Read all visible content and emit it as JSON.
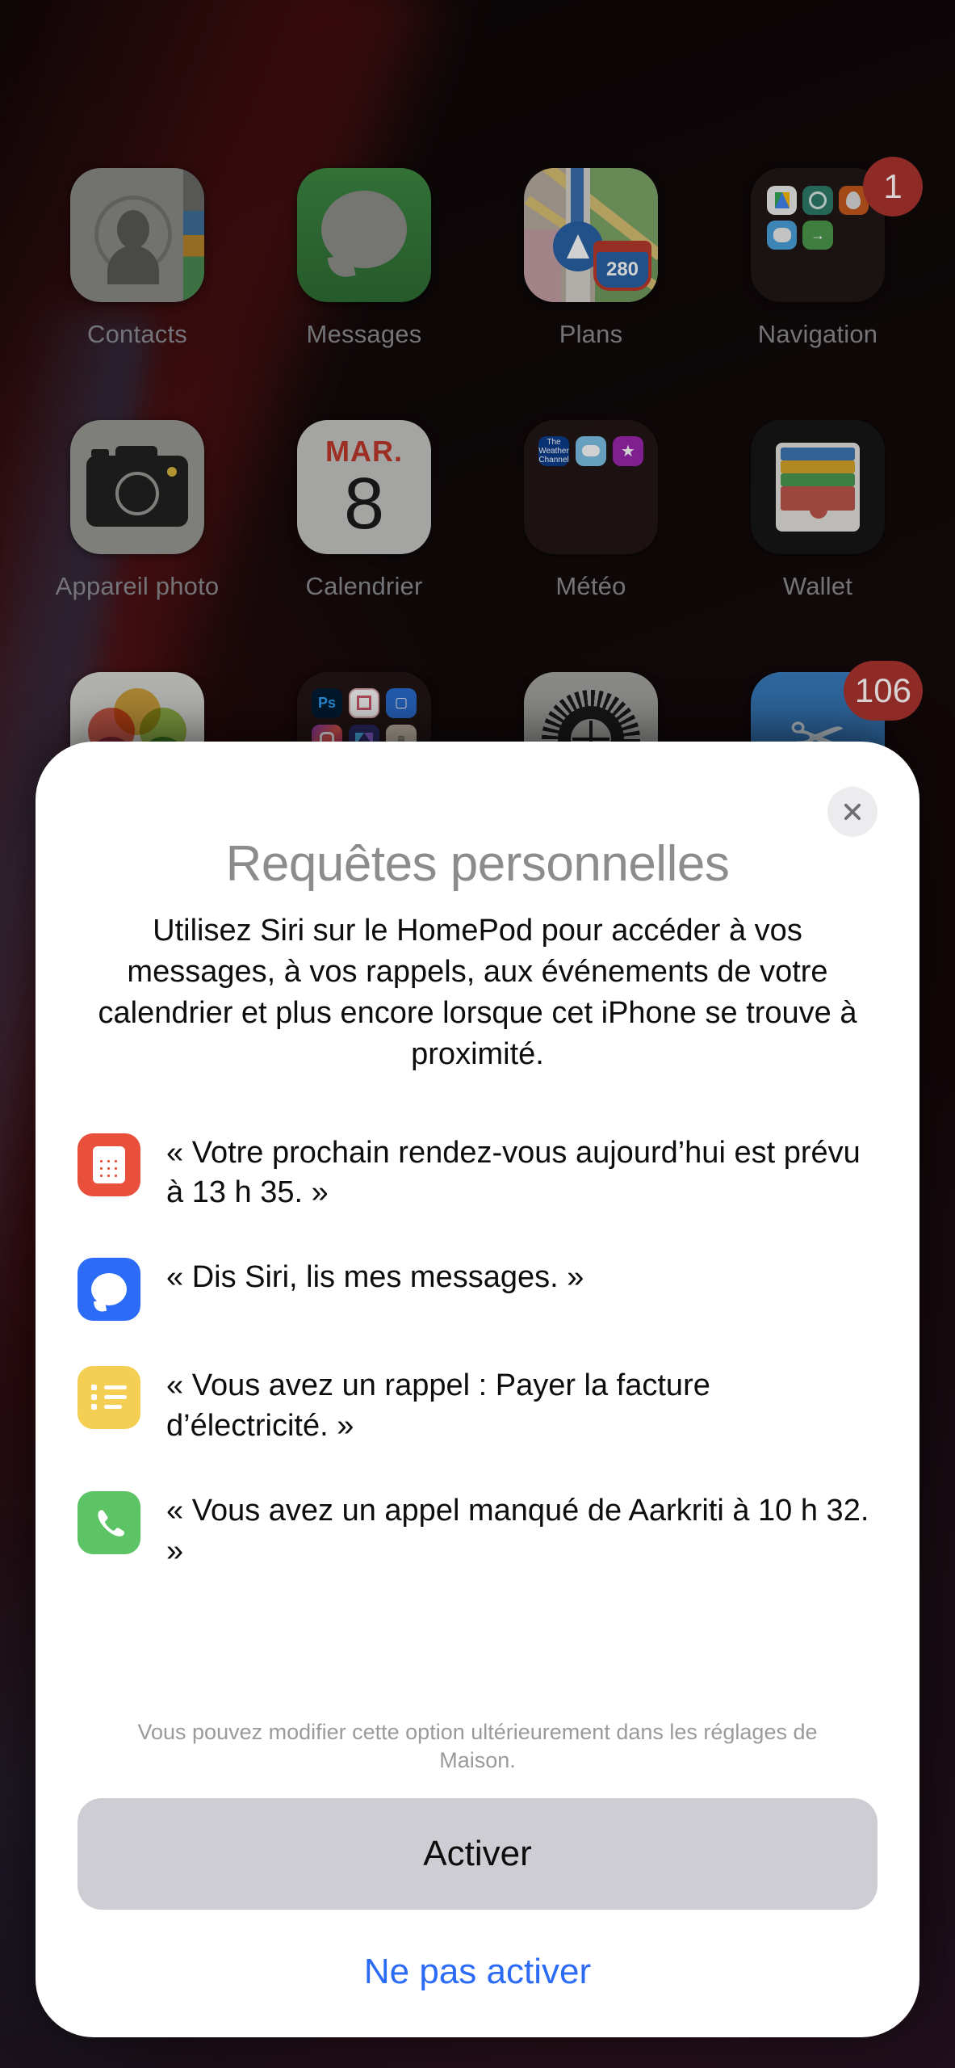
{
  "homescreen": {
    "rows": [
      [
        {
          "label": "Contacts",
          "icon": "contacts-icon",
          "badge": null
        },
        {
          "label": "Messages",
          "icon": "messages-icon",
          "badge": null
        },
        {
          "label": "Plans",
          "icon": "maps-icon",
          "badge": null,
          "highway_number": "280"
        },
        {
          "label": "Navigation",
          "icon": "navigation-folder-icon",
          "badge": "1"
        }
      ],
      [
        {
          "label": "Appareil photo",
          "icon": "camera-icon",
          "badge": null
        },
        {
          "label": "Calendrier",
          "icon": "calendar-icon",
          "badge": null,
          "month": "MAR.",
          "day": "8"
        },
        {
          "label": "Météo",
          "icon": "weather-folder-icon",
          "badge": null
        },
        {
          "label": "Wallet",
          "icon": "wallet-icon",
          "badge": null
        }
      ],
      [
        {
          "label": "",
          "icon": "photos-icon",
          "badge": null
        },
        {
          "label": "",
          "icon": "creative-folder-icon",
          "badge": null
        },
        {
          "label": "",
          "icon": "settings-icon",
          "badge": null
        },
        {
          "label": "",
          "icon": "app-store-icon",
          "badge": "106"
        }
      ]
    ],
    "folder_minis": {
      "navigation": [
        "Google Maps",
        "Citymapper",
        "Moovit",
        "Waze",
        "Transit"
      ],
      "weather": [
        "The Weather Channel",
        "Météo",
        "Star"
      ],
      "creative": [
        "Ps",
        "Lr",
        "FaceTime",
        "Instagram",
        "Affinity",
        "Files"
      ]
    },
    "weather_mini_label": "The Weather Channel"
  },
  "sheet": {
    "close_label": "×",
    "title": "Requêtes personnelles",
    "body": "Utilisez Siri sur le HomePod pour accéder à vos messages, à vos rappels, aux événements de votre calendrier et plus encore lorsque cet iPhone se trouve à proximité.",
    "examples": [
      {
        "icon": "calendar-icon",
        "color": "#e8503c",
        "text": "« Votre prochain rendez-vous aujourd’hui est prévu à 13 h 35. »"
      },
      {
        "icon": "messages-icon",
        "color": "#2b6bf5",
        "text": "« Dis Siri, lis mes messages. »"
      },
      {
        "icon": "reminders-icon",
        "color": "#f4cf54",
        "text": "« Vous avez un rappel : Payer la facture d’électricité. »"
      },
      {
        "icon": "phone-icon",
        "color": "#5dc466",
        "text": "« Vous avez un appel manqué de Aarkriti à 10 h 32. »"
      }
    ],
    "footnote": "Vous pouvez modifier cette option ultérieurement dans les réglages de Maison.",
    "primary_button": "Activer",
    "secondary_button": "Ne pas activer"
  },
  "colors": {
    "accent_blue": "#2b6bf5",
    "primary_button_bg": "#cdcdd3",
    "title_gray": "#8c8c8e",
    "footnote_gray": "#9a9a9c",
    "badge_red": "#8f2b26",
    "sheet_bg": "#ffffff"
  }
}
